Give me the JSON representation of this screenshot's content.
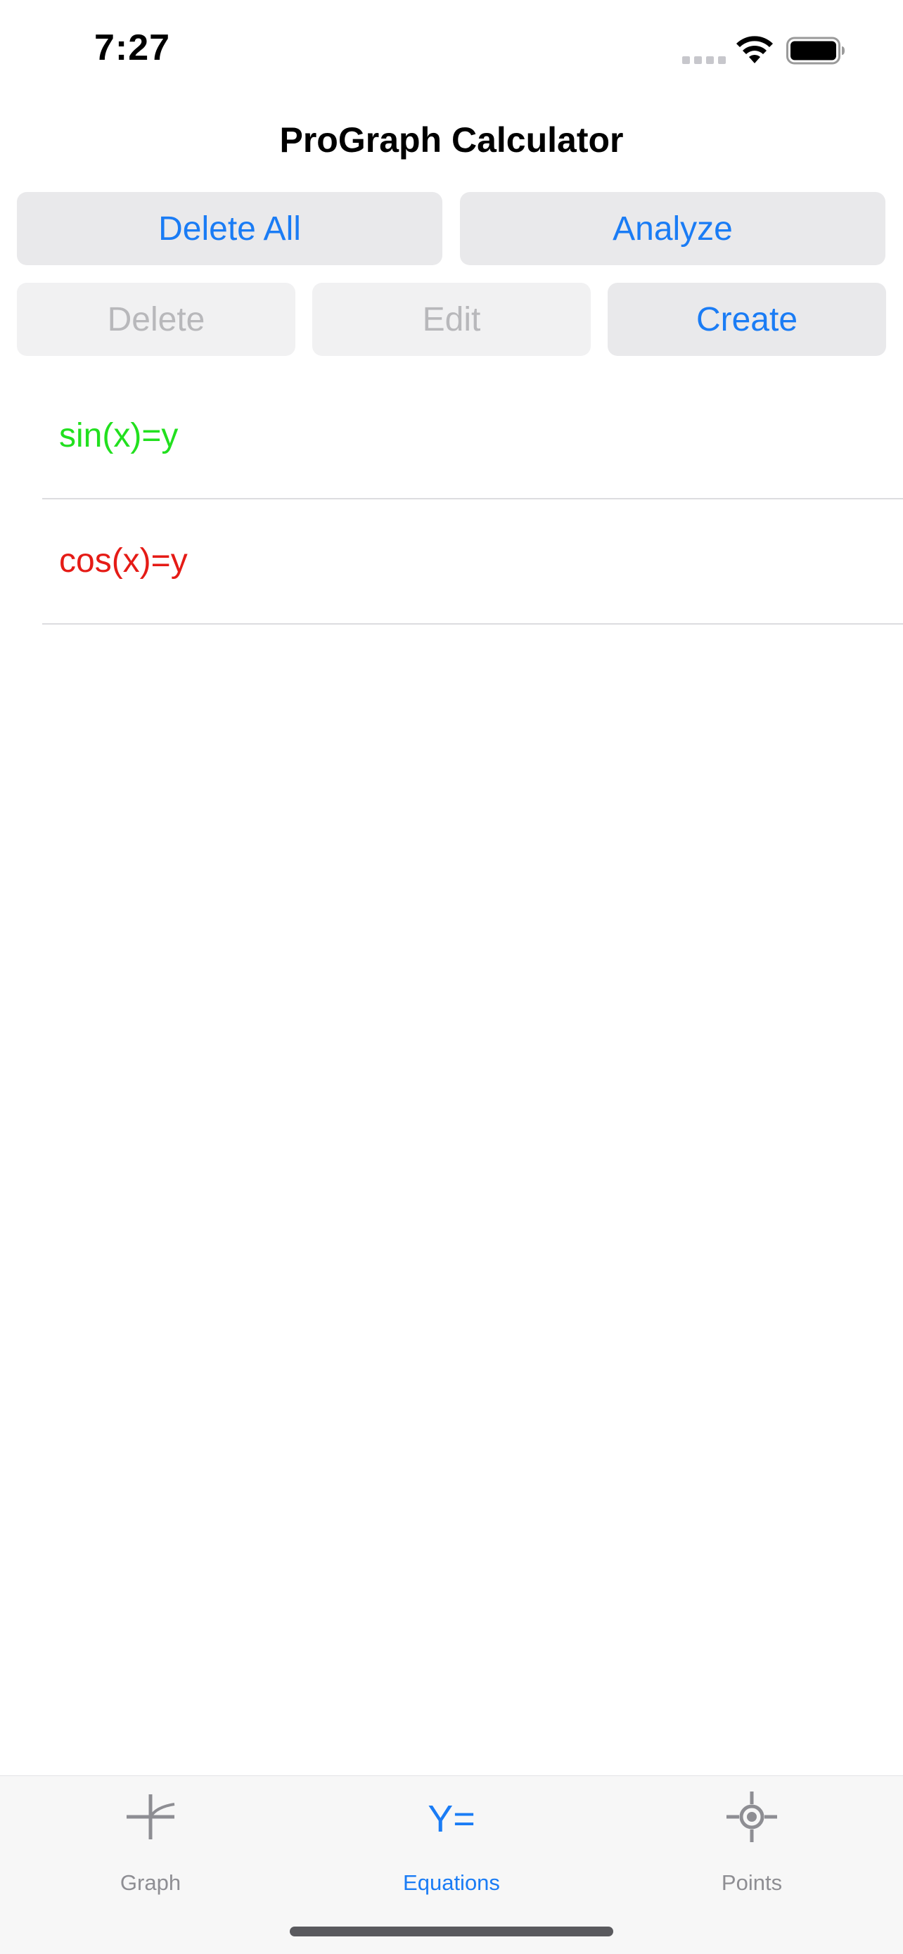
{
  "status_bar": {
    "time": "7:27"
  },
  "nav": {
    "title": "ProGraph Calculator"
  },
  "toolbar": {
    "delete_all_label": "Delete All",
    "analyze_label": "Analyze",
    "delete_label": "Delete",
    "edit_label": "Edit",
    "create_label": "Create"
  },
  "equations": [
    {
      "text": "sin(x)=y",
      "color": "#22e01f"
    },
    {
      "text": "cos(x)=y",
      "color": "#e51b16"
    }
  ],
  "tabs": [
    {
      "label": "Graph",
      "icon": "graph-icon",
      "active": false
    },
    {
      "label": "Equations",
      "icon": "y-equals-icon",
      "active": true,
      "icon_text": "Y="
    },
    {
      "label": "Points",
      "icon": "target-point-icon",
      "active": false
    }
  ],
  "colors": {
    "accent": "#1a7cf5",
    "button_bg": "#e9e9eb",
    "disabled_text": "#b8b8bb",
    "inactive_tab": "#8e8e93"
  }
}
